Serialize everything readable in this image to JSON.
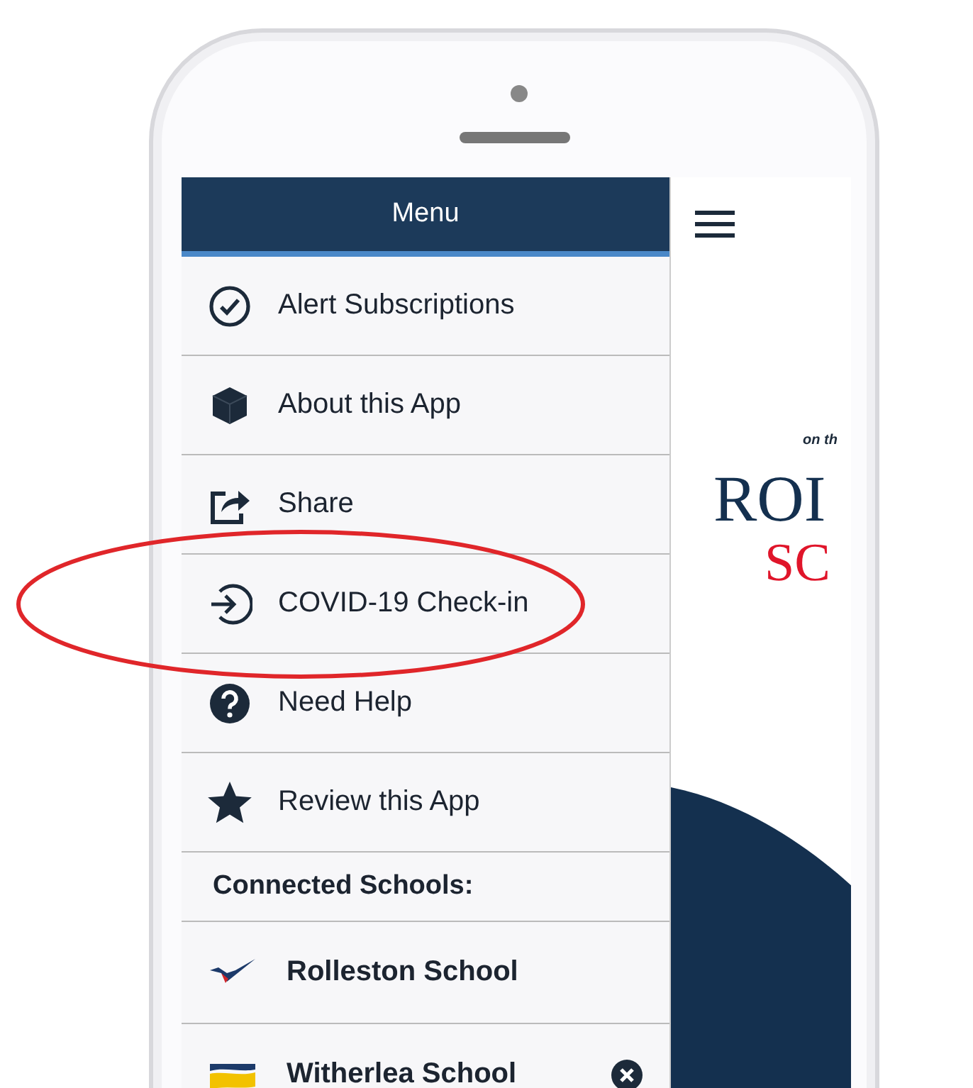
{
  "menu": {
    "title": "Menu",
    "items": [
      {
        "label": "Alert Subscriptions",
        "highlighted": false
      },
      {
        "label": "About this App",
        "highlighted": false
      },
      {
        "label": "Share",
        "highlighted": false
      },
      {
        "label": "COVID-19 Check-in",
        "highlighted": true
      },
      {
        "label": "Need Help",
        "highlighted": false
      },
      {
        "label": "Review this App",
        "highlighted": false
      }
    ],
    "section_title": "Connected Schools:",
    "schools": [
      {
        "name": "Rolleston School",
        "removable": false
      },
      {
        "name": "Witherlea School",
        "removable": true
      }
    ]
  },
  "background": {
    "tagline": "on th",
    "logo_line_1": "ROI",
    "logo_line_2": "SC"
  }
}
